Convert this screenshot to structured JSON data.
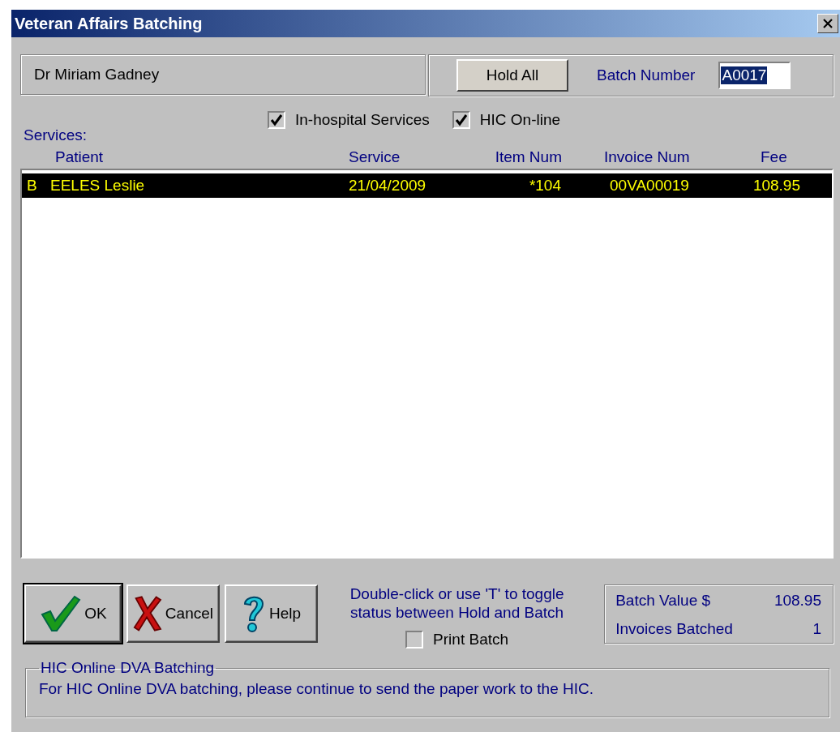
{
  "window": {
    "title": "Veteran Affairs Batching"
  },
  "doctor": "Dr Miriam Gadney",
  "hold_all_button": {
    "label": "Hold All"
  },
  "batch_number": {
    "label": "Batch Number",
    "value": "A0017",
    "selected": true
  },
  "options": [
    {
      "label": "In-hospital Services",
      "checked": true
    },
    {
      "label": "HIC On-line",
      "checked": true
    }
  ],
  "services": {
    "label": "Services:",
    "columns": [
      "Patient",
      "Service",
      "Item Num",
      "Invoice Num",
      "Fee"
    ],
    "rows": [
      {
        "status": "B",
        "patient": "EELES Leslie",
        "service": "21/04/2009",
        "item_num": "*104",
        "invoice_num": "00VA00019",
        "fee": "108.95",
        "selected": true
      }
    ]
  },
  "buttons": [
    {
      "kind": "ok",
      "label": "OK",
      "default": true
    },
    {
      "kind": "cancel",
      "label": "Cancel",
      "default": false
    },
    {
      "kind": "help",
      "label": "Help",
      "default": false
    }
  ],
  "hint": [
    "Double-click or use 'T' to toggle",
    "status between Hold and Batch"
  ],
  "print_batch": {
    "label": "Print Batch",
    "checked": false
  },
  "summary": [
    {
      "label": "Batch Value $",
      "value": "108.95"
    },
    {
      "label": "Invoices Batched",
      "value": "1"
    }
  ],
  "online_group": {
    "title": "HIC Online DVA Batching",
    "text": "For HIC Online DVA batching, please continue to send the paper work to the HIC."
  }
}
